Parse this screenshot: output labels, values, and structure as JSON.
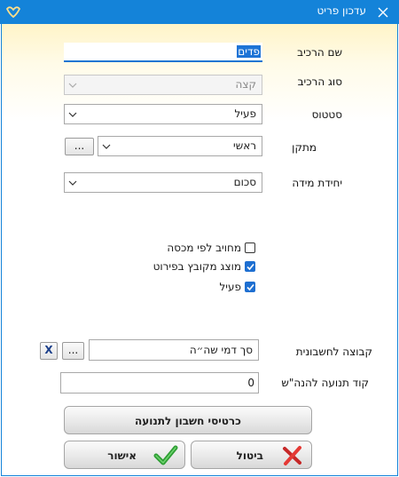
{
  "window": {
    "title": "עדכון פריט"
  },
  "form": {
    "component_name": {
      "label": "שם הרכיב",
      "value": "פדים"
    },
    "component_type": {
      "label": "סוג הרכיב",
      "value": "קצה"
    },
    "status": {
      "label": "סטטוס",
      "value": "פעיל"
    },
    "device": {
      "label": "מתקן",
      "value": "ראשי",
      "browse_label": "..."
    },
    "unit": {
      "label": "יחידת מידה",
      "value": "סכום"
    }
  },
  "checkboxes": [
    {
      "label": "מחויב לפי מכסה",
      "checked": false
    },
    {
      "label": "מוצג מקובץ בפירוט",
      "checked": true
    },
    {
      "label": "פעיל",
      "checked": true
    }
  ],
  "accounting": {
    "group_label": "קבוצה לחשבונית",
    "group_value": "סך דמי שה״ה",
    "browse_label": "...",
    "clear_label": "X",
    "movement_code_label": "קוד תנועה להנה\"ש",
    "movement_code_value": "0"
  },
  "buttons": {
    "account_cards": "כרטיסי חשבון לתנועה",
    "cancel": "ביטול",
    "confirm": "אישור"
  },
  "colors": {
    "titlebar": "#1483d9",
    "accent": "#1e6fd1"
  }
}
